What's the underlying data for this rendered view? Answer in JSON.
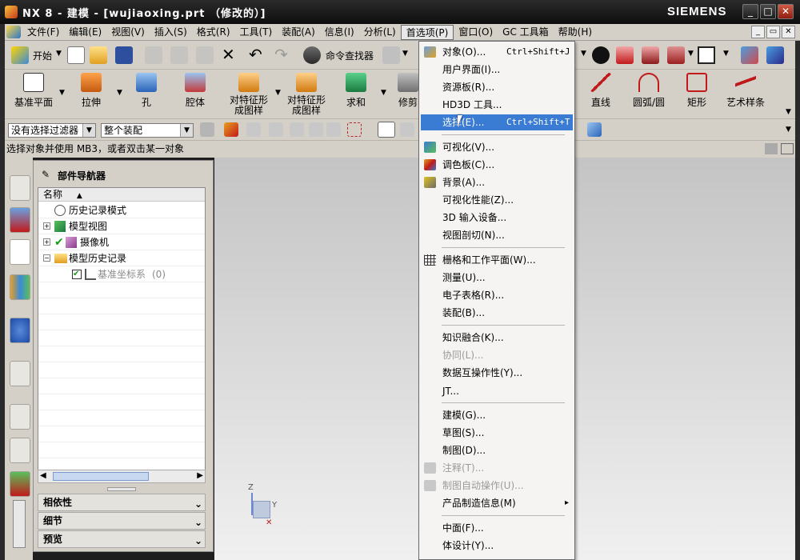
{
  "window": {
    "title": "NX 8 - 建模 - [wujiaoxing.prt （修改的）]",
    "brand": "SIEMENS",
    "min": "_",
    "max": "□",
    "close": "✕"
  },
  "menubar": [
    "文件(F)",
    "编辑(E)",
    "视图(V)",
    "插入(S)",
    "格式(R)",
    "工具(T)",
    "装配(A)",
    "信息(I)",
    "分析(L)",
    "首选项(P)",
    "窗口(O)",
    "GC 工具箱",
    "帮助(H)"
  ],
  "toolbar1": {
    "start_label": "开始",
    "command_finder": "命令查找器"
  },
  "toolbar2": {
    "left": [
      {
        "label": "基准平面"
      },
      {
        "label": "拉伸"
      },
      {
        "label": "孔"
      },
      {
        "label": "腔体"
      },
      {
        "label": "对特征形\n成图样"
      },
      {
        "label": "对特征形\n成图样"
      },
      {
        "label": "求和"
      },
      {
        "label": "修剪"
      }
    ],
    "right": [
      {
        "label": "直线"
      },
      {
        "label": "圆弧/圆"
      },
      {
        "label": "矩形"
      },
      {
        "label": "艺术样条"
      }
    ]
  },
  "toolbar3": {
    "filter": "没有选择过滤器",
    "scope": "整个装配"
  },
  "status": "选择对象并使用 MB3，或者双击某一对象",
  "navigator": {
    "title": "部件导航器",
    "column": "名称",
    "items": [
      {
        "label": "历史记录模式"
      },
      {
        "label": "模型视图"
      },
      {
        "label": "摄像机"
      },
      {
        "label": "模型历史记录"
      },
      {
        "label": "基准坐标系",
        "extra": "(0)"
      }
    ],
    "sections": [
      "相依性",
      "细节",
      "预览"
    ]
  },
  "preferences_menu": [
    {
      "label": "对象(O)...",
      "shortcut": "Ctrl+Shift+J"
    },
    {
      "label": "用户界面(I)..."
    },
    {
      "label": "资源板(R)..."
    },
    {
      "label": "HD3D 工具..."
    },
    {
      "label": "选择(E)...",
      "shortcut": "Ctrl+Shift+T"
    },
    {
      "label": "可视化(V)..."
    },
    {
      "label": "调色板(C)..."
    },
    {
      "label": "背景(A)..."
    },
    {
      "label": "可视化性能(Z)..."
    },
    {
      "label": "3D 输入设备..."
    },
    {
      "label": "视图剖切(N)..."
    },
    {
      "label": "栅格和工作平面(W)..."
    },
    {
      "label": "测量(U)..."
    },
    {
      "label": "电子表格(R)..."
    },
    {
      "label": "装配(B)..."
    },
    {
      "label": "知识融合(K)..."
    },
    {
      "label": "协同(L)..."
    },
    {
      "label": "数据互操作性(Y)..."
    },
    {
      "label": "JT..."
    },
    {
      "label": "建模(G)..."
    },
    {
      "label": "草图(S)..."
    },
    {
      "label": "制图(D)..."
    },
    {
      "label": "注释(T)..."
    },
    {
      "label": "制图自动操作(U)..."
    },
    {
      "label": "产品制造信息(M)",
      "submenu": "▸"
    },
    {
      "label": "中面(F)..."
    },
    {
      "label": "体设计(Y)..."
    }
  ],
  "triad": {
    "z": "Z",
    "y": "Y"
  }
}
